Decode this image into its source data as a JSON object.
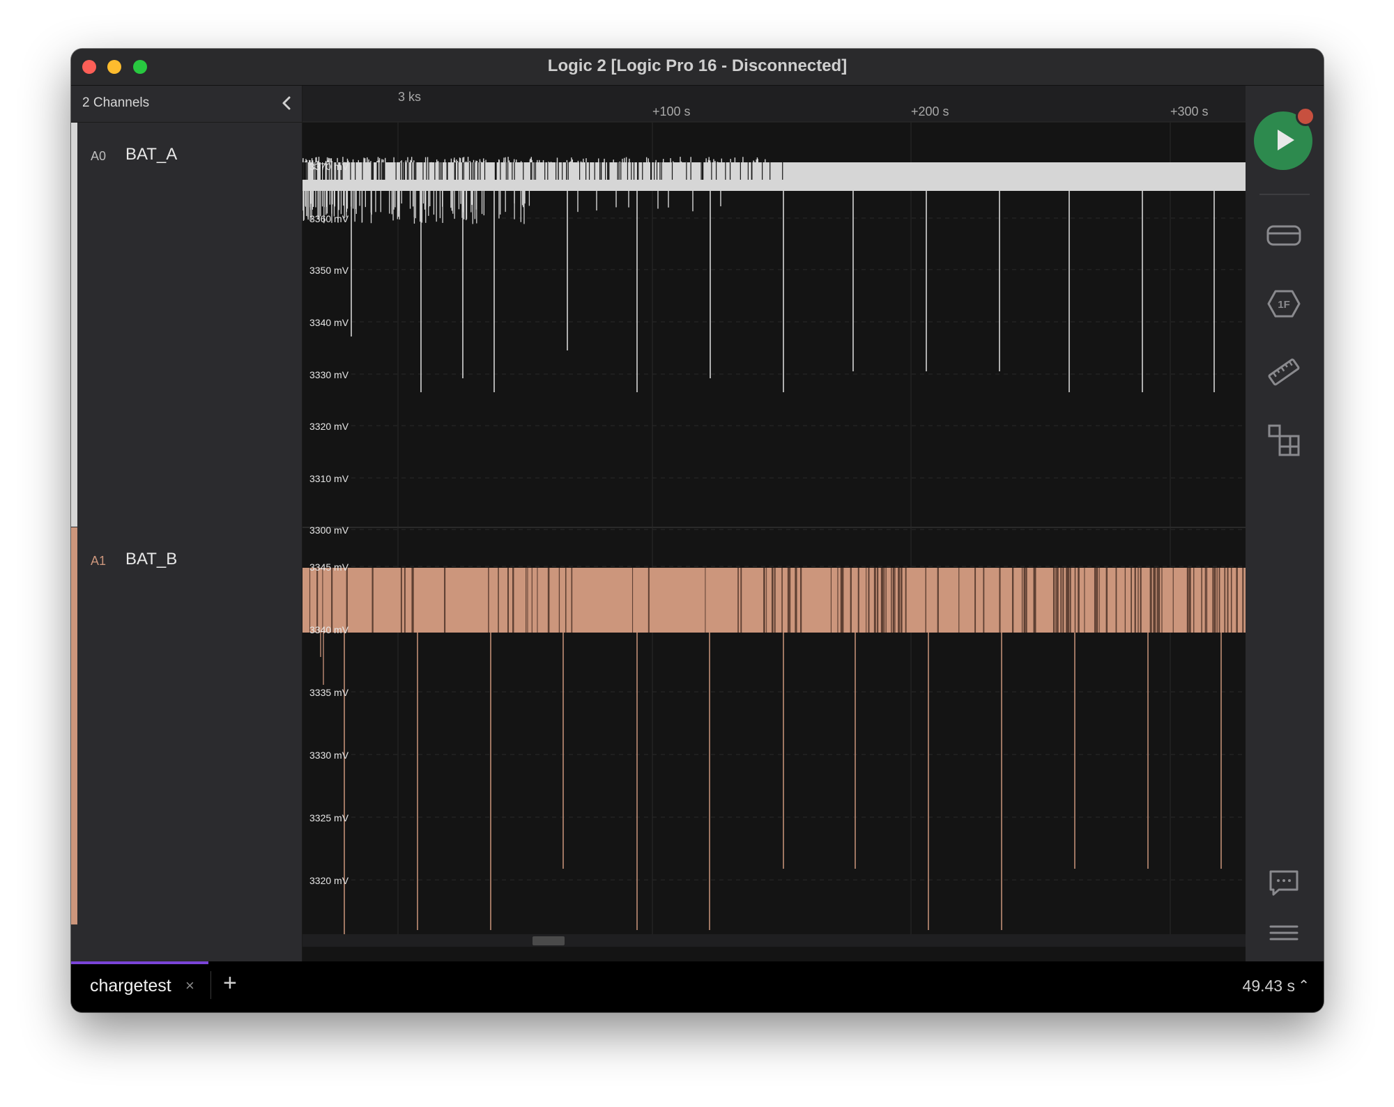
{
  "window": {
    "title": "Logic 2 [Logic Pro 16 - Disconnected]"
  },
  "sidebar": {
    "channel_count": "2 Channels",
    "channels": [
      {
        "id": "A0",
        "name": "BAT_A",
        "color": "#d6d6d6"
      },
      {
        "id": "A1",
        "name": "BAT_B",
        "color": "#cc967c"
      }
    ]
  },
  "timeline": {
    "origin_label": "3 ks",
    "ticks": [
      "+100 s",
      "+200 s",
      "+300 s"
    ]
  },
  "plots": {
    "a0": {
      "y_labels": [
        "3370 mV",
        "3360 mV",
        "3350 mV",
        "3340 mV",
        "3330 mV",
        "3320 mV",
        "3310 mV",
        "3300 mV"
      ]
    },
    "a1": {
      "y_labels": [
        "3345 mV",
        "3340 mV",
        "3335 mV",
        "3330 mV",
        "3325 mV",
        "3320 mV"
      ]
    }
  },
  "rightbar": {
    "icons": [
      "play-icon",
      "device-icon",
      "analyzer-icon",
      "measure-icon",
      "extensions-icon",
      "feedback-icon",
      "menu-icon"
    ],
    "accent": "#2d8a4e",
    "record_color": "#c7503f"
  },
  "tabs": [
    {
      "label": "chargetest",
      "close": "×"
    }
  ],
  "tabbar": {
    "add": "+",
    "duration": "49.43 s",
    "caret": "⌃"
  },
  "colors": {
    "bat_a": "#d6d6d6",
    "bat_b": "#cc967c",
    "tab_indicator": "#7a44d8"
  }
}
